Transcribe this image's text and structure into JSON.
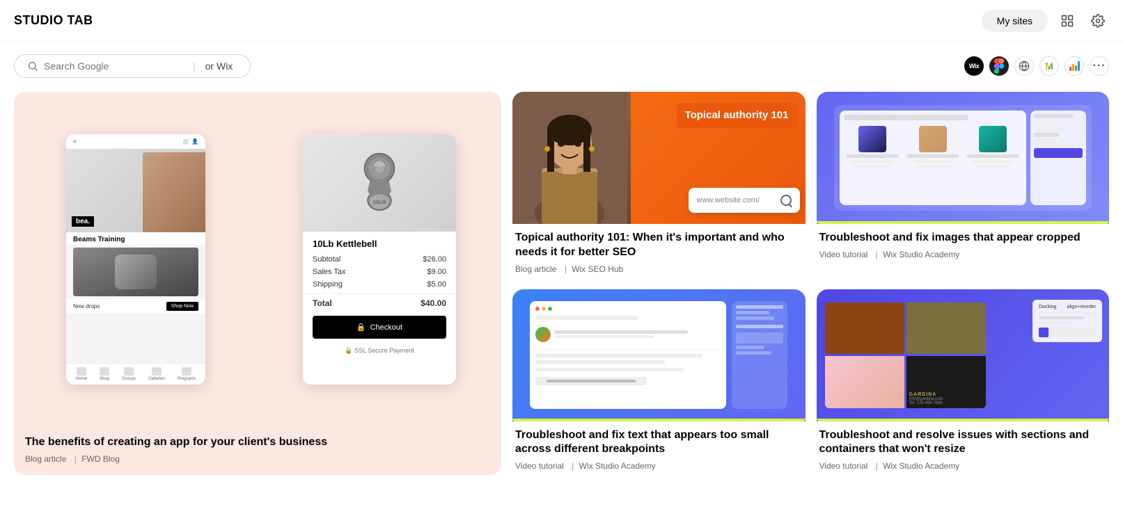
{
  "header": {
    "logo": "STUDIO TAB",
    "my_sites_label": "My sites",
    "settings_icon": "gear-icon",
    "history_icon": "history-icon"
  },
  "search": {
    "placeholder": "Search Google",
    "or_wix": "or Wix"
  },
  "extensions": [
    {
      "id": "wix",
      "label": "WIX",
      "type": "wix"
    },
    {
      "id": "figma",
      "label": "Figma",
      "type": "figma"
    },
    {
      "id": "globe",
      "label": "Globe",
      "type": "globe"
    },
    {
      "id": "gmail",
      "label": "Gmail",
      "type": "gmail"
    },
    {
      "id": "analytics",
      "label": "Analytics",
      "type": "analytics"
    },
    {
      "id": "more",
      "label": "More",
      "type": "more"
    }
  ],
  "featured": {
    "phone_brand": "bea.",
    "phone_brand_label": "Beams Training",
    "phone_cta": "New drops",
    "phone_btn": "Shop Now",
    "phone_nav": [
      "Home",
      "Shop",
      "Groups",
      "Galleries",
      "Programs"
    ],
    "cart_product": "10Lb Kettlebell",
    "cart_lines": [
      {
        "label": "Subtotal",
        "value": "$26.00"
      },
      {
        "label": "Sales Tax",
        "value": "$9.00"
      },
      {
        "label": "Shipping",
        "value": "$5.00"
      }
    ],
    "cart_total_label": "Total",
    "cart_total_value": "$40.00",
    "cart_checkout": "Checkout",
    "cart_ssl": "SSL Secure Payment",
    "title": "The benefits of creating an app for your client's business",
    "type": "Blog article",
    "source": "FWD Blog"
  },
  "cards": [
    {
      "id": "topical-authority",
      "thumb_type": "topical",
      "thumb_label": "Topical authority 101",
      "search_placeholder": "www.website.com/",
      "title": "Topical authority 101: When it's important and who needs it for better SEO",
      "type": "Blog article",
      "source": "Wix SEO Hub"
    },
    {
      "id": "troubleshoot-images",
      "thumb_type": "blue-services",
      "title": "Troubleshoot and fix images that appear cropped",
      "type": "Video tutorial",
      "source": "Wix Studio Academy"
    },
    {
      "id": "troubleshoot-text",
      "thumb_type": "playground",
      "title": "Troubleshoot and fix text that appears too small across different breakpoints",
      "type": "Video tutorial",
      "source": "Wix Studio Academy"
    },
    {
      "id": "troubleshoot-sections",
      "thumb_type": "gardina",
      "title": "Troubleshoot and resolve issues with sections and containers that won't resize",
      "type": "Video tutorial",
      "source": "Wix Studio Academy"
    }
  ]
}
